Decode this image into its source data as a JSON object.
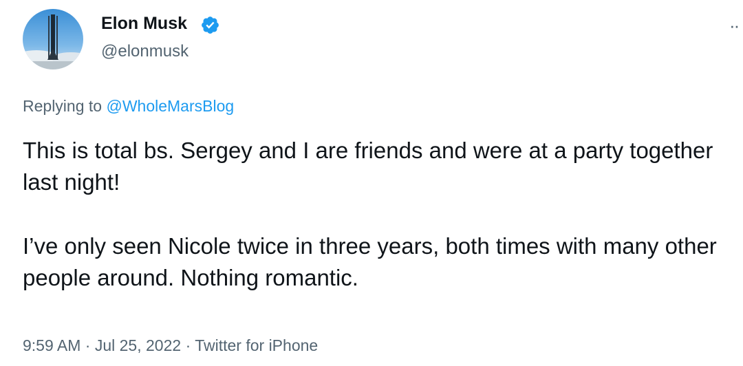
{
  "author": {
    "name": "Elon Musk",
    "handle": "@elonmusk",
    "verified": true,
    "avatar_icon": "rocket-launch-avatar"
  },
  "reply": {
    "prefix": "Replying to",
    "handle": "@WholeMarsBlog"
  },
  "tweet": {
    "paragraphs": [
      "This is total bs. Sergey and I are friends and were at a party together last night!",
      "I’ve only seen Nicole twice in three years, both times with many other people around. Nothing romantic."
    ]
  },
  "meta": {
    "time": "9:59 AM",
    "separator": "·",
    "date": "Jul 25, 2022",
    "source": "Twitter for iPhone"
  },
  "colors": {
    "text": "#0f1419",
    "secondary": "#536471",
    "link": "#1d9bf0",
    "verified": "#1d9bf0"
  },
  "icons": {
    "more": "more-horizontal-icon",
    "verified": "verified-badge-icon"
  }
}
